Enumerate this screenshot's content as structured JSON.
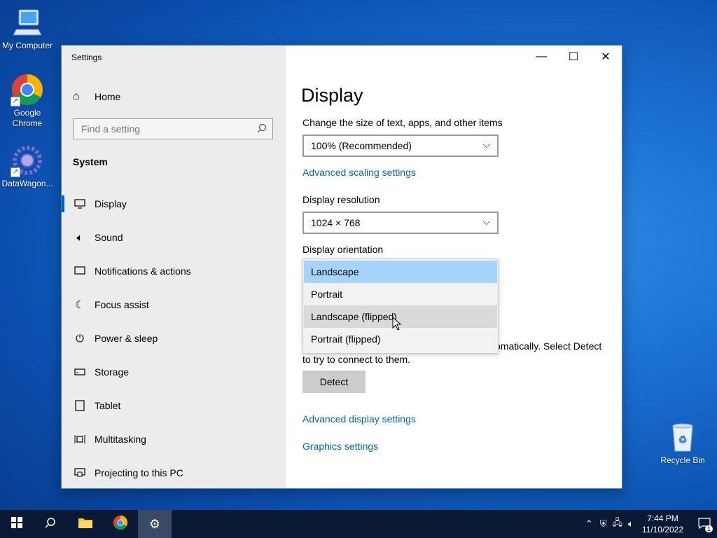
{
  "desktop": {
    "icons": [
      {
        "label": "My Computer"
      },
      {
        "label": "Google Chrome"
      },
      {
        "label": "DataWagon..."
      },
      {
        "label": "Recycle Bin"
      }
    ]
  },
  "window": {
    "title": "Settings",
    "controls": {
      "minimize": "—",
      "maximize": "☐",
      "close": "✕"
    }
  },
  "sidebar": {
    "home": "Home",
    "search_placeholder": "Find a setting",
    "group": "System",
    "items": [
      {
        "label": "Display",
        "icon": "display-icon",
        "active": true
      },
      {
        "label": "Sound",
        "icon": "sound-icon"
      },
      {
        "label": "Notifications & actions",
        "icon": "notifications-icon"
      },
      {
        "label": "Focus assist",
        "icon": "moon-icon"
      },
      {
        "label": "Power & sleep",
        "icon": "power-icon"
      },
      {
        "label": "Storage",
        "icon": "storage-icon"
      },
      {
        "label": "Tablet",
        "icon": "tablet-icon"
      },
      {
        "label": "Multitasking",
        "icon": "multitasking-icon"
      },
      {
        "label": "Projecting to this PC",
        "icon": "projecting-icon"
      }
    ]
  },
  "main": {
    "title": "Display",
    "scale_label": "Change the size of text, apps, and other items",
    "scale_value": "100% (Recommended)",
    "advanced_scaling_link": "Advanced scaling settings",
    "resolution_label": "Display resolution",
    "resolution_value": "1024 × 768",
    "orientation_label": "Display orientation",
    "orientation_options": [
      "Landscape",
      "Portrait",
      "Landscape (flipped)",
      "Portrait (flipped)"
    ],
    "orientation_selected": "Landscape",
    "orientation_hover": "Landscape (flipped)",
    "detect_text_line1": "omatically. Select Detect",
    "detect_text_line2": "to try to connect to them.",
    "detect_button": "Detect",
    "advanced_display_link": "Advanced display settings",
    "graphics_link": "Graphics settings"
  },
  "taskbar": {
    "time": "7:44 PM",
    "date": "11/10/2022",
    "notification_count": "1"
  },
  "colors": {
    "accent": "#0063b1",
    "link": "#0067b8",
    "selected_option": "#a6d4fa"
  }
}
